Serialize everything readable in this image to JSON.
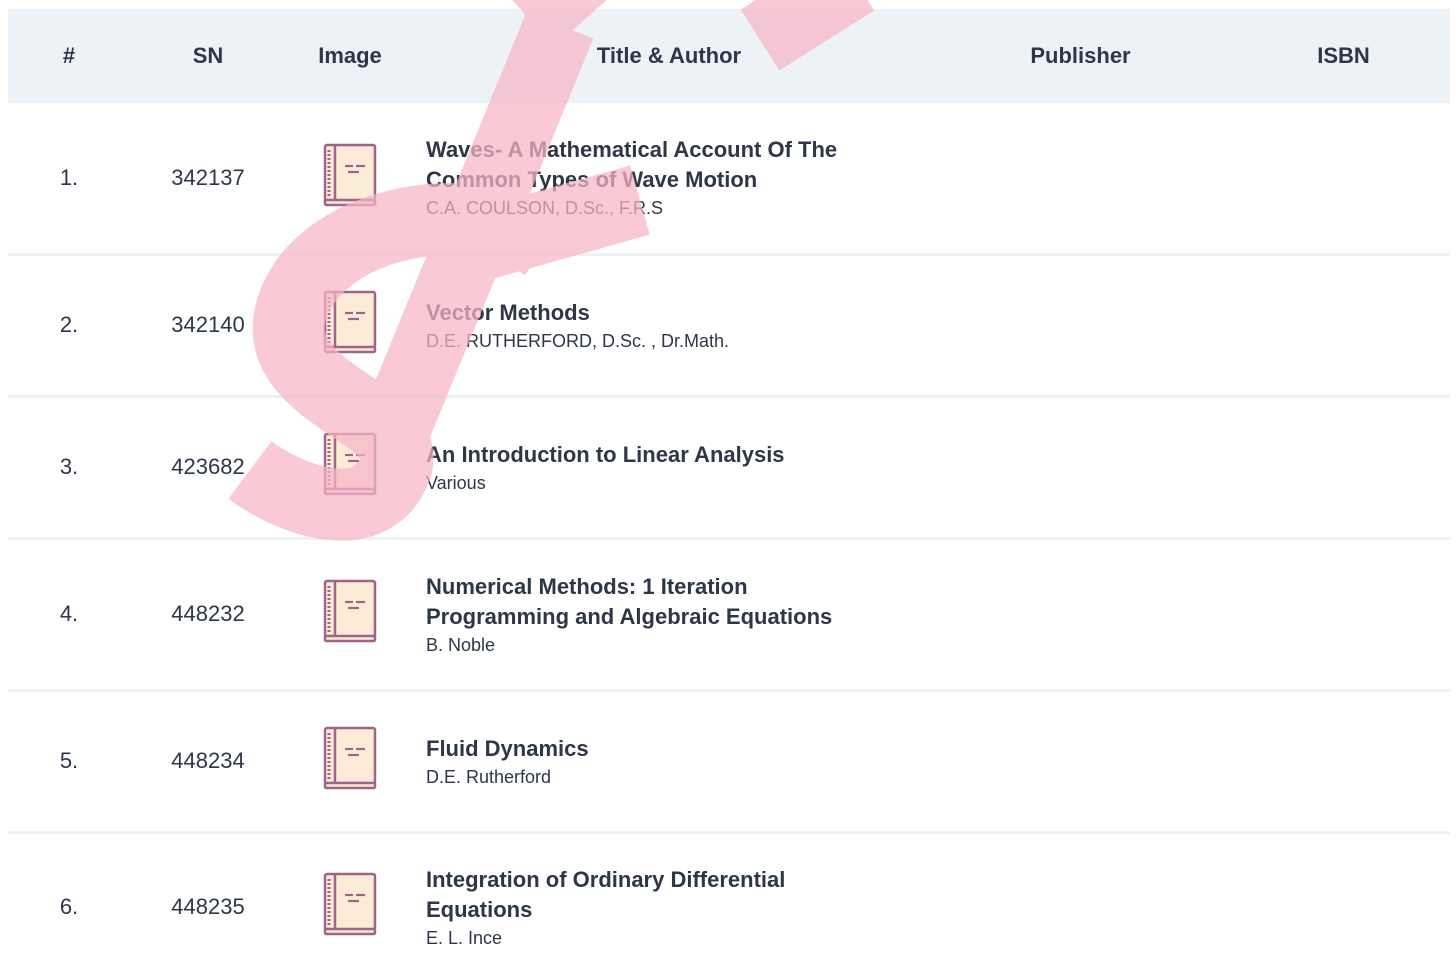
{
  "table": {
    "headers": {
      "num": "#",
      "sn": "SN",
      "image": "Image",
      "title_author": "Title & Author",
      "publisher": "Publisher",
      "isbn": "ISBN"
    },
    "rows": [
      {
        "num": "1.",
        "sn": "342137",
        "title": "Waves- A Mathematical Account Of The Common Types of Wave Motion",
        "author": "C.A. COULSON, D.Sc., F.R.S",
        "publisher": "",
        "isbn": "",
        "icon": "book-icon"
      },
      {
        "num": "2.",
        "sn": "342140",
        "title": "Vector Methods",
        "author": "D.E. RUTHERFORD, D.Sc. , Dr.Math.",
        "publisher": "",
        "isbn": "",
        "icon": "book-icon"
      },
      {
        "num": "3.",
        "sn": "423682",
        "title": "An Introduction to Linear Analysis",
        "author": "Various",
        "publisher": "",
        "isbn": "",
        "icon": "book-icon"
      },
      {
        "num": "4.",
        "sn": "448232",
        "title": "Numerical Methods: 1 Iteration Programming and Algebraic Equations",
        "author": "B. Noble",
        "publisher": "",
        "isbn": "",
        "icon": "book-icon"
      },
      {
        "num": "5.",
        "sn": "448234",
        "title": "Fluid Dynamics",
        "author": "D.E. Rutherford",
        "publisher": "",
        "isbn": "",
        "icon": "book-icon"
      },
      {
        "num": "6.",
        "sn": "448235",
        "title": "Integration of Ordinary Differential Equations",
        "author": "E. L. Ince",
        "publisher": "",
        "isbn": "",
        "icon": "book-icon"
      }
    ]
  },
  "colors": {
    "header_bg": "#edf2f7",
    "text": "#2d3748",
    "book_cover": "#fbebd7",
    "book_outline": "#9f6487",
    "watermark": "#f7b6c7"
  }
}
